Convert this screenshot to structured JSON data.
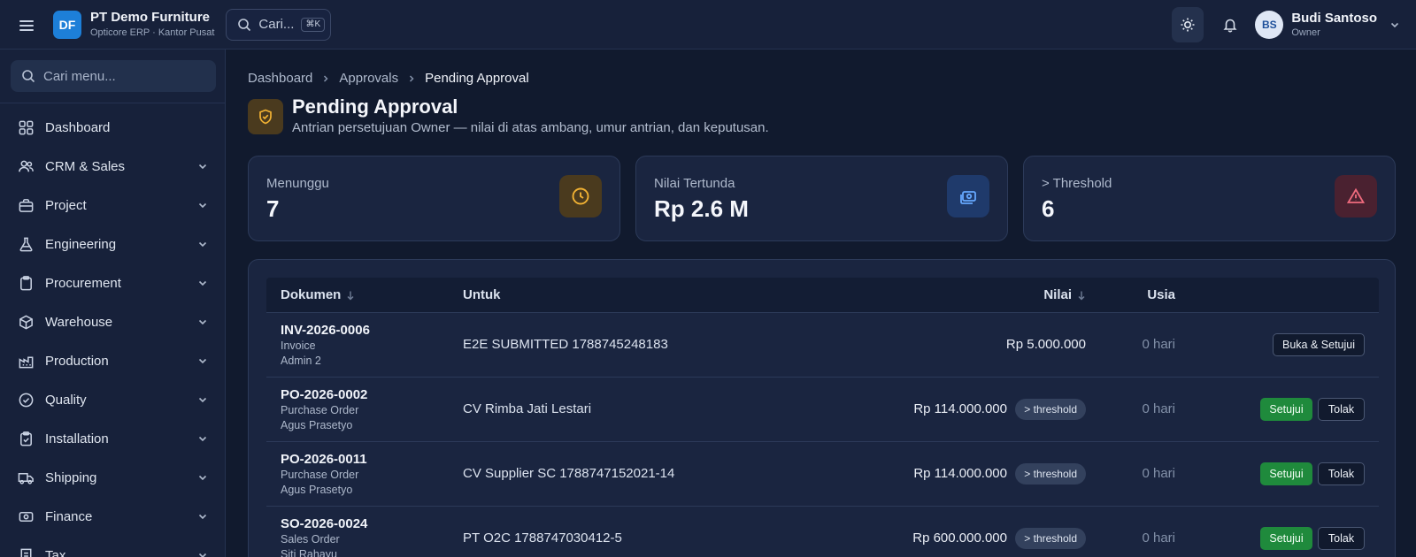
{
  "header": {
    "logo": "DF",
    "company": "PT Demo Furniture",
    "subtitle": "Opticore ERP · Kantor Pusat",
    "search_label": "Cari...",
    "search_shortcut": "⌘K",
    "user_initials": "BS",
    "user_name": "Budi Santoso",
    "user_role": "Owner"
  },
  "sidebar": {
    "search_placeholder": "Cari menu...",
    "items": [
      {
        "label": "Dashboard",
        "icon": "dashboard-grid-icon"
      },
      {
        "label": "CRM & Sales",
        "icon": "users-icon"
      },
      {
        "label": "Project",
        "icon": "briefcase-icon"
      },
      {
        "label": "Engineering",
        "icon": "flask-icon"
      },
      {
        "label": "Procurement",
        "icon": "clipboard-icon"
      },
      {
        "label": "Warehouse",
        "icon": "box-icon"
      },
      {
        "label": "Production",
        "icon": "factory-icon"
      },
      {
        "label": "Quality",
        "icon": "check-circle-icon"
      },
      {
        "label": "Installation",
        "icon": "clipboard-check-icon"
      },
      {
        "label": "Shipping",
        "icon": "truck-icon"
      },
      {
        "label": "Finance",
        "icon": "banknote-icon"
      },
      {
        "label": "Tax",
        "icon": "receipt-icon"
      }
    ]
  },
  "breadcrumb": [
    "Dashboard",
    "Approvals",
    "Pending Approval"
  ],
  "page": {
    "title": "Pending Approval",
    "subtitle": "Antrian persetujuan Owner — nilai di atas ambang, umur antrian, dan keputusan."
  },
  "kpis": [
    {
      "label": "Menunggu",
      "value": "7",
      "icon": "clock-icon",
      "icon_bg": "#4a3a1e",
      "icon_color": "#f2b233"
    },
    {
      "label": "Nilai Tertunda",
      "value": "Rp 2.6 M",
      "icon": "cash-icon",
      "icon_bg": "#1f3a6b",
      "icon_color": "#66a8ff"
    },
    {
      "label": "> Threshold",
      "value": "6",
      "icon": "warning-triangle-icon",
      "icon_bg": "#4a2130",
      "icon_color": "#f06b7e"
    }
  ],
  "table": {
    "columns": [
      "Dokumen",
      "Untuk",
      "Nilai",
      "Usia"
    ],
    "rows": [
      {
        "doc_no": "INV-2026-0006",
        "doc_type": "Invoice",
        "requester": "Admin 2",
        "for": "E2E SUBMITTED 1788745248183",
        "value": "Rp 5.000.000",
        "badge": "",
        "age": "0 hari",
        "actions": [
          "Buka & Setujui"
        ]
      },
      {
        "doc_no": "PO-2026-0002",
        "doc_type": "Purchase Order",
        "requester": "Agus Prasetyo",
        "for": "CV Rimba Jati Lestari",
        "value": "Rp 114.000.000",
        "badge": "> threshold",
        "age": "0 hari",
        "actions": [
          "Setujui",
          "Tolak"
        ]
      },
      {
        "doc_no": "PO-2026-0011",
        "doc_type": "Purchase Order",
        "requester": "Agus Prasetyo",
        "for": "CV Supplier SC 1788747152021-14",
        "value": "Rp 114.000.000",
        "badge": "> threshold",
        "age": "0 hari",
        "actions": [
          "Setujui",
          "Tolak"
        ]
      },
      {
        "doc_no": "SO-2026-0024",
        "doc_type": "Sales Order",
        "requester": "Siti Rahayu",
        "for": "PT O2C 1788747030412-5",
        "value": "Rp 600.000.000",
        "badge": "> threshold",
        "age": "0 hari",
        "actions": [
          "Setujui",
          "Tolak"
        ]
      }
    ]
  },
  "colors": {
    "accent": "#1d7fd8",
    "approve": "#1f8a3c",
    "background": "#111a2e",
    "surface": "#1a2540"
  }
}
